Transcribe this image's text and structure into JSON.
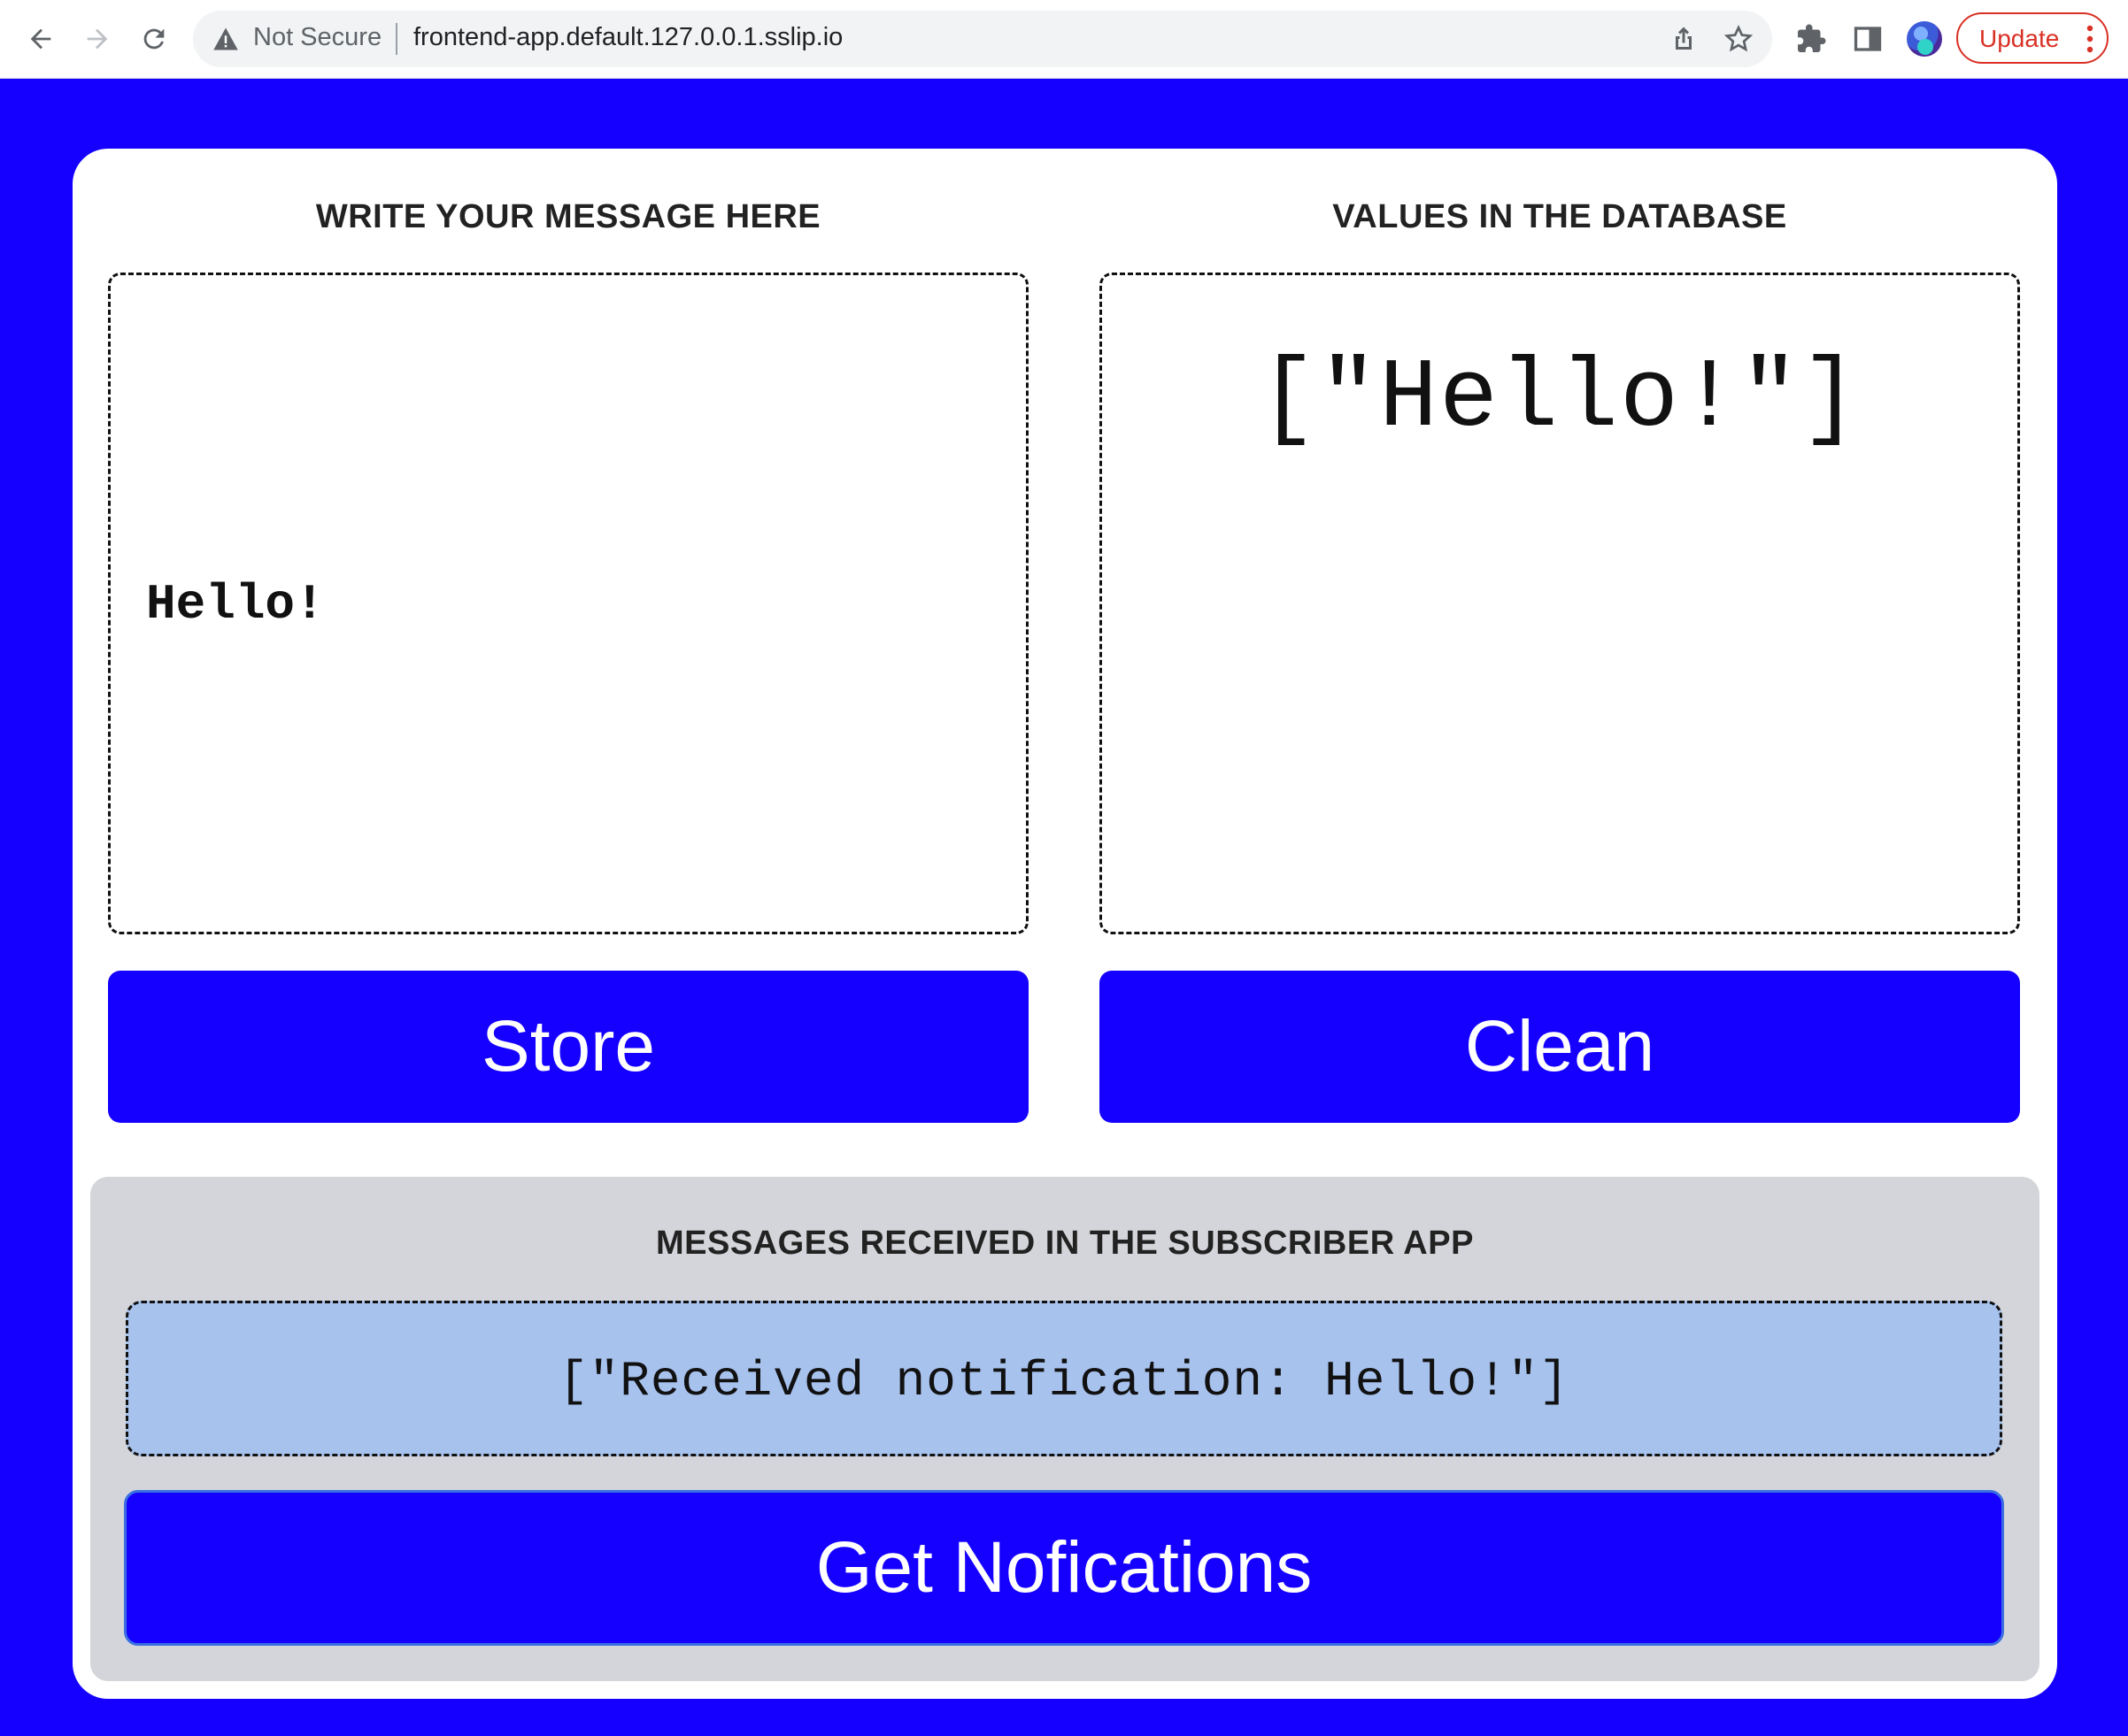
{
  "browser": {
    "security_label": "Not Secure",
    "url": "frontend-app.default.127.0.0.1.sslip.io",
    "update_label": "Update"
  },
  "left_panel": {
    "title": "WRITE YOUR MESSAGE HERE",
    "message_value": "Hello!",
    "store_label": "Store"
  },
  "right_panel": {
    "title": "VALUES IN THE DATABASE",
    "values_text": "[\"Hello!\"]",
    "clean_label": "Clean"
  },
  "subscriber": {
    "title": "MESSAGES RECEIVED IN THE SUBSCRIBER APP",
    "messages_text": "[\"Received notification: Hello!\"]",
    "button_label": "Get Nofications"
  },
  "colors": {
    "accent_blue": "#1500ff",
    "notification_bg": "#a8c2ee",
    "panel_gray": "#d4d5da",
    "update_red": "#d93025"
  },
  "icons": {
    "back": "arrow-left",
    "forward": "arrow-right",
    "reload": "reload",
    "warning": "warning-triangle",
    "share": "share",
    "bookmark": "star",
    "extensions": "puzzle-piece",
    "side_panel": "side-panel",
    "profile": "avatar",
    "menu": "vertical-dots"
  }
}
